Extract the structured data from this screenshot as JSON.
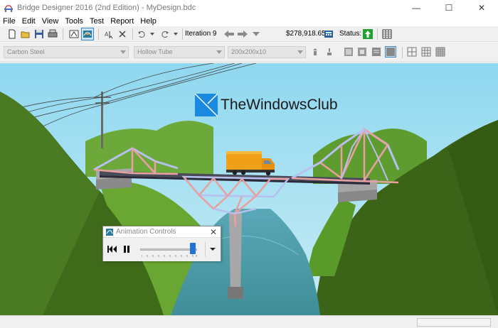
{
  "window": {
    "title": "Bridge Designer 2016 (2nd Edition) - MyDesign.bdc",
    "minimize": "—",
    "maximize": "☐",
    "close": "✕"
  },
  "menu": [
    "File",
    "Edit",
    "View",
    "Tools",
    "Test",
    "Report",
    "Help"
  ],
  "toolbar": {
    "iteration": "Iteration 9",
    "cost": "$278,918.65",
    "status_label": "Status:",
    "status_color": "#22a030"
  },
  "member_props": {
    "material": "Carbon Steel",
    "section": "Hollow Tube",
    "size": "200x200x10"
  },
  "watermark": {
    "text": "TheWindowsClub"
  },
  "animation_controls": {
    "title": "Animation Controls",
    "close": "✕",
    "speed_fraction": 0.93
  },
  "colors": {
    "sky": "#96dcf0",
    "hill_dark": "#3c6418",
    "hill_light": "#7ab832",
    "water": "#4a9aa0",
    "tension": "#e8a0a0",
    "compression": "#b8c0f0",
    "truck": "#f0a018",
    "accent": "#1f73d9"
  }
}
